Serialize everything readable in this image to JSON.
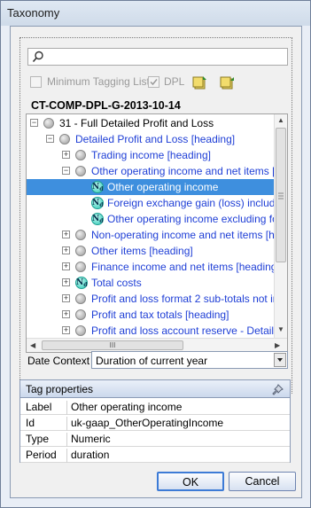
{
  "window": {
    "title": "Taxonomy"
  },
  "search": {
    "value": ""
  },
  "options": {
    "min_tagging_label": "Minimum Tagging List",
    "dpl_label": "DPL",
    "dpl_checked": true
  },
  "tree": {
    "header": "CT-COMP-DPL-G-2013-10-14",
    "rows": [
      {
        "label": "31 - Full Detailed Profit and Loss",
        "toggle": "−",
        "icon": "ball",
        "blue": false
      },
      {
        "label": "Detailed Profit and Loss [heading]",
        "toggle": "−",
        "icon": "ball",
        "blue": true
      },
      {
        "label": "Trading income [heading]",
        "toggle": "+",
        "icon": "ball",
        "blue": true
      },
      {
        "label": "Other operating income and net items [h",
        "toggle": "−",
        "icon": "ball",
        "blue": true
      },
      {
        "label": "Other operating income",
        "toggle": "",
        "icon": "nd",
        "blue": false,
        "selected": true
      },
      {
        "label": "Foreign exchange gain (loss) includ",
        "toggle": "",
        "icon": "nd",
        "blue": true
      },
      {
        "label": "Other operating income excluding fo",
        "toggle": "",
        "icon": "nd",
        "blue": true
      },
      {
        "label": "Non-operating income and net items [he",
        "toggle": "+",
        "icon": "ball",
        "blue": true
      },
      {
        "label": "Other items [heading]",
        "toggle": "+",
        "icon": "ball",
        "blue": true
      },
      {
        "label": "Finance income and net items [heading]",
        "toggle": "+",
        "icon": "ball",
        "blue": true
      },
      {
        "label": "Total costs",
        "toggle": "+",
        "icon": "nd",
        "blue": true
      },
      {
        "label": "Profit and loss format 2 sub-totals not in",
        "toggle": "+",
        "icon": "ball",
        "blue": true
      },
      {
        "label": "Profit and tax totals [heading]",
        "toggle": "+",
        "icon": "ball",
        "blue": true
      },
      {
        "label": "Profit and loss account reserve - Detail",
        "toggle": "+",
        "icon": "ball",
        "blue": true
      }
    ],
    "hscroll_thumb": "III"
  },
  "date_context": {
    "label": "Date Context",
    "value": "Duration of current year"
  },
  "tag_properties": {
    "title": "Tag properties",
    "rows": [
      {
        "key": "Label",
        "value": "Other operating income"
      },
      {
        "key": "Id",
        "value": "uk-gaap_OtherOperatingIncome"
      },
      {
        "key": "Type",
        "value": "Numeric"
      },
      {
        "key": "Period",
        "value": "duration"
      }
    ]
  },
  "buttons": {
    "ok": "OK",
    "cancel": "Cancel"
  }
}
